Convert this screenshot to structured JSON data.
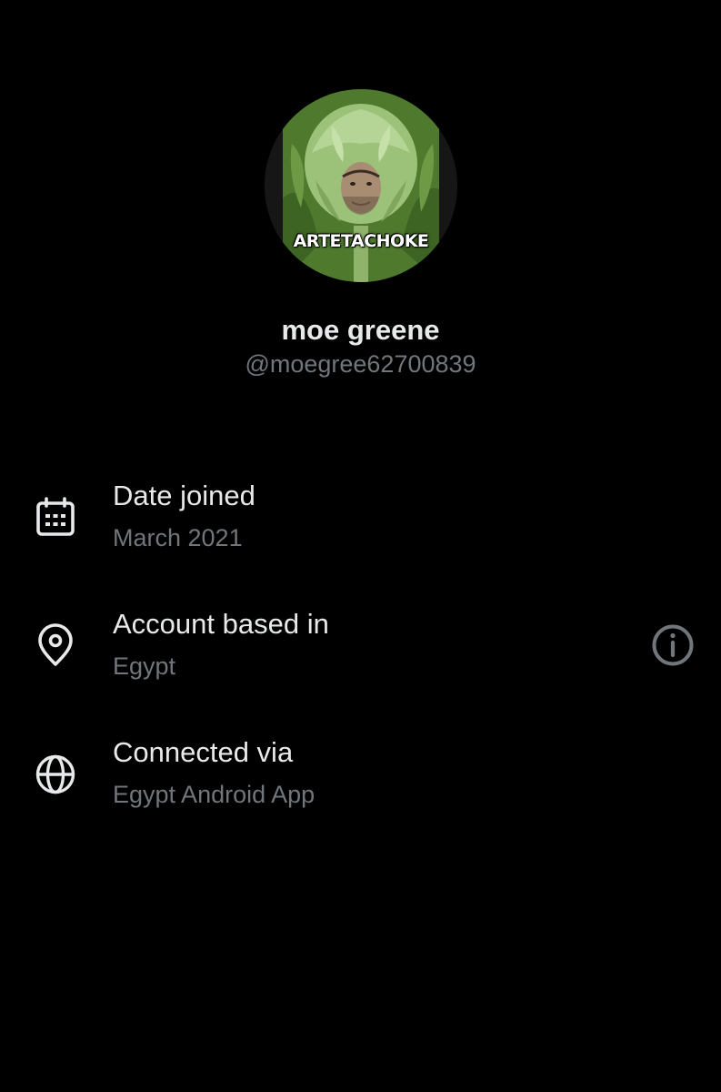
{
  "profile": {
    "avatar_caption": "ARTETACHOKE",
    "display_name": "moe greene",
    "handle": "@moegree62700839"
  },
  "about": {
    "rows": [
      {
        "icon": "calendar-icon",
        "label": "Date joined",
        "value": "March 2021"
      },
      {
        "icon": "location-pin-icon",
        "label": "Account based in",
        "value": "Egypt",
        "action_icon": "info-icon"
      },
      {
        "icon": "globe-icon",
        "label": "Connected via",
        "value": "Egypt Android App"
      }
    ]
  },
  "colors": {
    "background": "#000000",
    "primary_text": "#e7e9ea",
    "secondary_text": "#71767b"
  }
}
